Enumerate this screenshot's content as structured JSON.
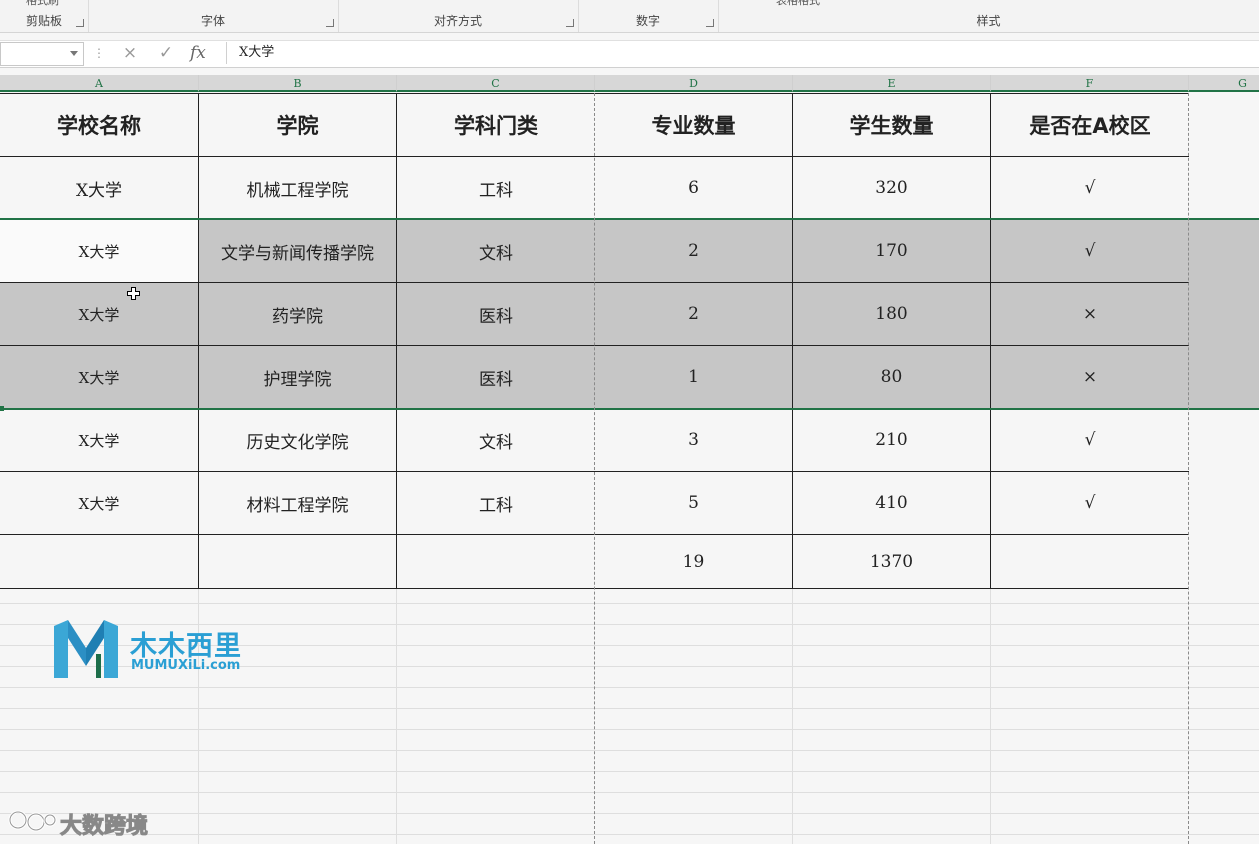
{
  "ribbon": {
    "groups": [
      {
        "label": "剪贴板",
        "partial": "格式刷"
      },
      {
        "label": "字体",
        "partial": ""
      },
      {
        "label": "对齐方式",
        "partial": ""
      },
      {
        "label": "数字",
        "partial": ""
      },
      {
        "label": "样式",
        "partial": "表格格式"
      }
    ]
  },
  "formula_bar": {
    "name_box": "",
    "content": "X大学",
    "cancel_icon": "×",
    "enter_icon": "✓",
    "fx_label": "fx"
  },
  "columns": [
    "A",
    "B",
    "C",
    "D",
    "E",
    "F",
    "G"
  ],
  "table": {
    "headers": [
      "学校名称",
      "学院",
      "学科门类",
      "专业数量",
      "学生数量",
      "是否在A校区"
    ],
    "rows": [
      [
        "X大学",
        "机械工程学院",
        "工科",
        "6",
        "320",
        "√"
      ],
      [
        "X大学",
        "文学与新闻传播学院",
        "文科",
        "2",
        "170",
        "√"
      ],
      [
        "X大学",
        "药学院",
        "医科",
        "2",
        "180",
        "×"
      ],
      [
        "X大学",
        "护理学院",
        "医科",
        "1",
        "80",
        "×"
      ],
      [
        "X大学",
        "历史文化学院",
        "文科",
        "3",
        "210",
        "√"
      ],
      [
        "X大学",
        "材料工程学院",
        "工科",
        "5",
        "410",
        "√"
      ]
    ],
    "totals": [
      "",
      "",
      "",
      "19",
      "1370",
      ""
    ]
  },
  "logo": {
    "chinese": "木木西里",
    "english": "MUMUXiLi.com"
  },
  "watermark": {
    "text": "大数跨境"
  },
  "colors": {
    "accent": "#217346",
    "highlight": "#c6c6c6",
    "logo": "#2a9fd4"
  }
}
